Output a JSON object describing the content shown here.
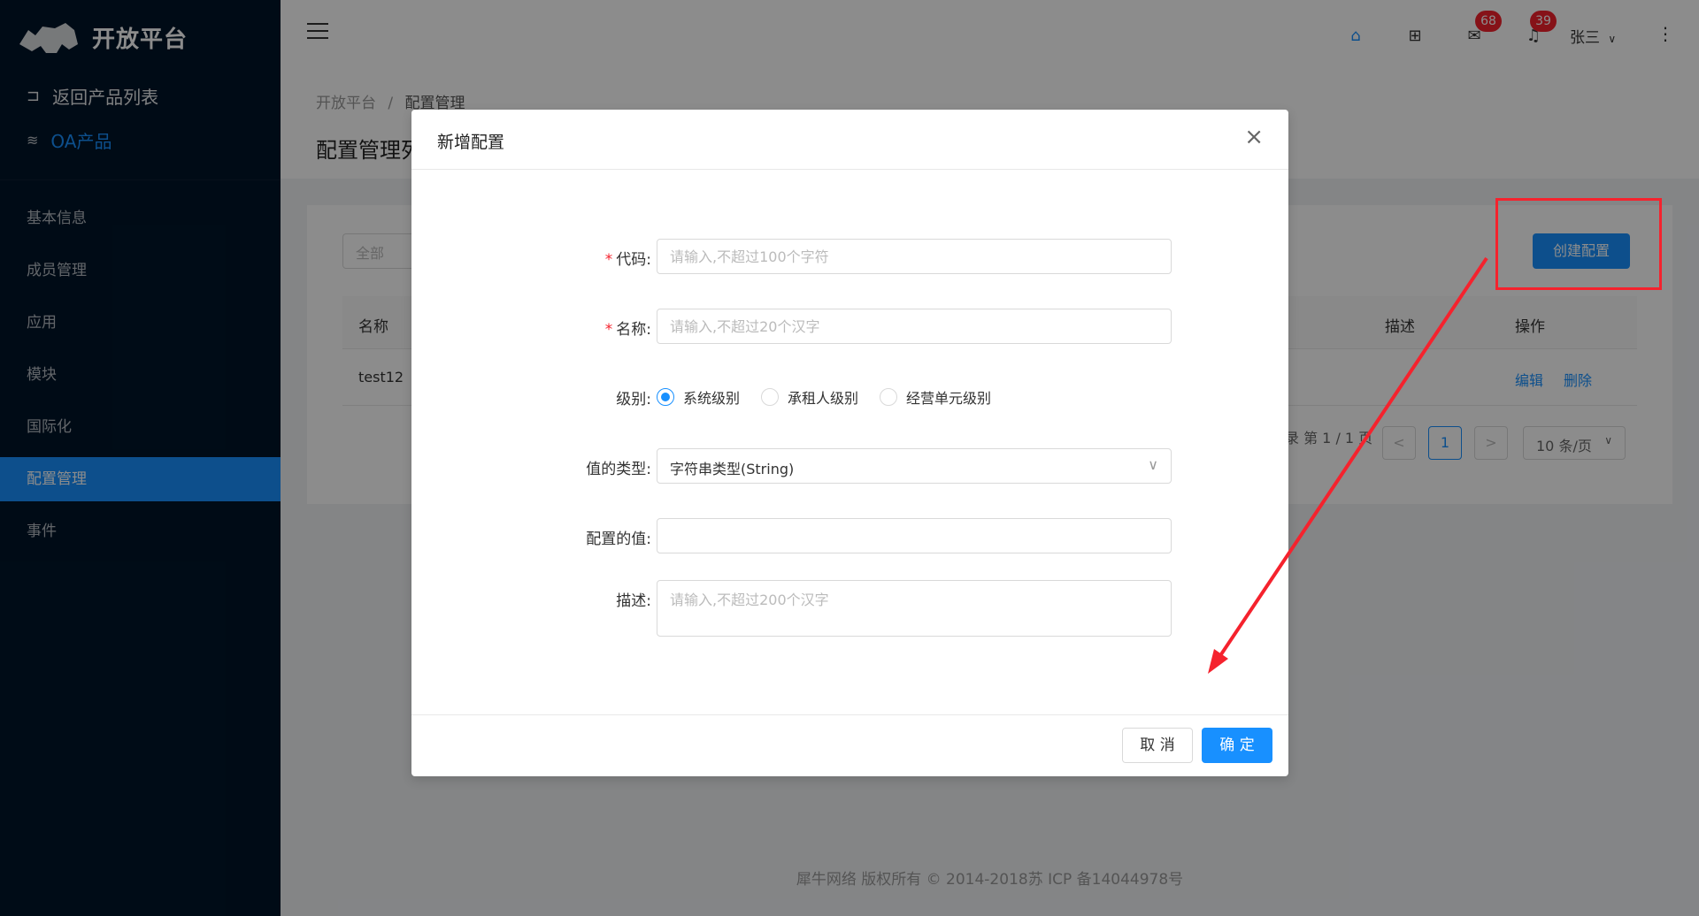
{
  "sidebar": {
    "logo_text": "开放平台",
    "back_label": "返回产品列表",
    "product_label": "OA产品",
    "items": [
      {
        "label": "基本信息"
      },
      {
        "label": "成员管理"
      },
      {
        "label": "应用"
      },
      {
        "label": "模块"
      },
      {
        "label": "国际化"
      },
      {
        "label": "配置管理",
        "active": true
      },
      {
        "label": "事件"
      }
    ]
  },
  "header": {
    "mail_count": "68",
    "bell_count": "39",
    "user_name": "张三"
  },
  "page": {
    "breadcrumb": [
      "开放平台",
      "/",
      "配置管理"
    ],
    "title": "配置管理列表"
  },
  "card": {
    "filter_placeholder": "全部",
    "create_label": "创建配置",
    "columns": [
      "名称",
      "描述",
      "操作"
    ],
    "rows": [
      {
        "name": "test12",
        "actions": [
          "编辑",
          "删除"
        ]
      }
    ],
    "pager": {
      "summary": "录 第 1 / 1 页",
      "page": "1",
      "prev": "<",
      "next": ">",
      "page_size": "10 条/页"
    }
  },
  "footer": {
    "text": "犀牛网络 版权所有 © 2014-2018苏 ICP 备14044978号"
  },
  "modal": {
    "title": "新增配置",
    "close_icon": "×",
    "fields": {
      "code": {
        "label": "代码:",
        "placeholder": "请输入,不超过100个字符",
        "required": true
      },
      "name": {
        "label": "名称:",
        "placeholder": "请输入,不超过20个汉字",
        "required": true
      },
      "level": {
        "label": "级别:",
        "options": [
          "系统级别",
          "承租人级别",
          "经营单元级别"
        ],
        "selected": "系统级别"
      },
      "value_type": {
        "label": "值的类型:",
        "value": "字符串类型(String)"
      },
      "config_value": {
        "label": "配置的值:",
        "value": ""
      },
      "description": {
        "label": "描述:",
        "placeholder": "请输入,不超过200个汉字"
      }
    },
    "cancel_label": "取 消",
    "ok_label": "确 定"
  },
  "colors": {
    "accent": "#1890ff",
    "sidebar_bg": "#001529",
    "annotation": "#f5222d"
  }
}
